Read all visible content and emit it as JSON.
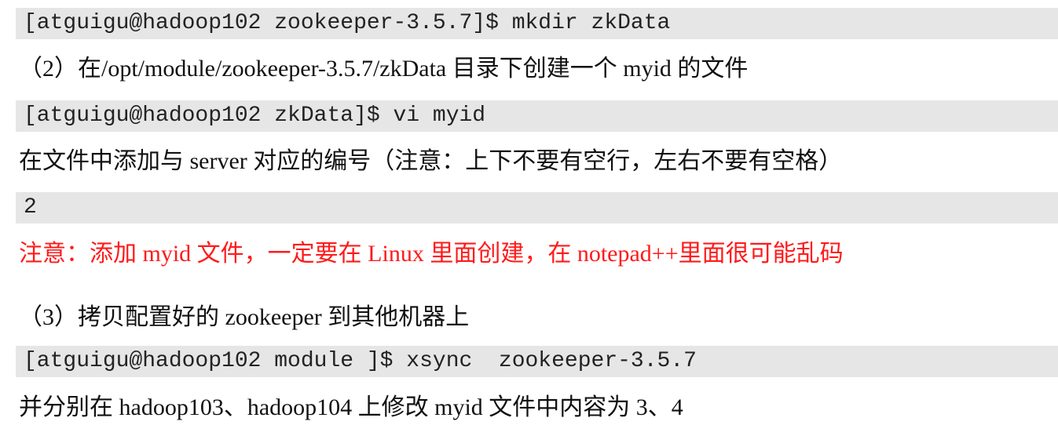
{
  "lines": [
    {
      "kind": "code",
      "text": "[atguigu@hadoop102 zookeeper-3.5.7]$ mkdir zkData"
    },
    {
      "kind": "text",
      "text": "（2）在/opt/module/zookeeper-3.5.7/zkData 目录下创建一个 myid 的文件"
    },
    {
      "kind": "code",
      "text": "[atguigu@hadoop102 zkData]$ vi myid"
    },
    {
      "kind": "text",
      "text": "在文件中添加与 server 对应的编号（注意：上下不要有空行，左右不要有空格）"
    },
    {
      "kind": "code",
      "text": "2"
    },
    {
      "kind": "warning",
      "text": "注意：添加 myid 文件，一定要在 Linux 里面创建，在 notepad++里面很可能乱码"
    },
    {
      "kind": "text",
      "text": "（3）拷贝配置好的 zookeeper 到其他机器上"
    },
    {
      "kind": "code",
      "text": "[atguigu@hadoop102 module ]$ xsync  zookeeper-3.5.7"
    },
    {
      "kind": "text",
      "text": "并分别在 hadoop103、hadoop104 上修改 myid 文件中内容为 3、4"
    }
  ],
  "colors": {
    "code_background": "#e6e6e6",
    "warning_text": "#ff1a1a",
    "body_text": "#111111"
  }
}
